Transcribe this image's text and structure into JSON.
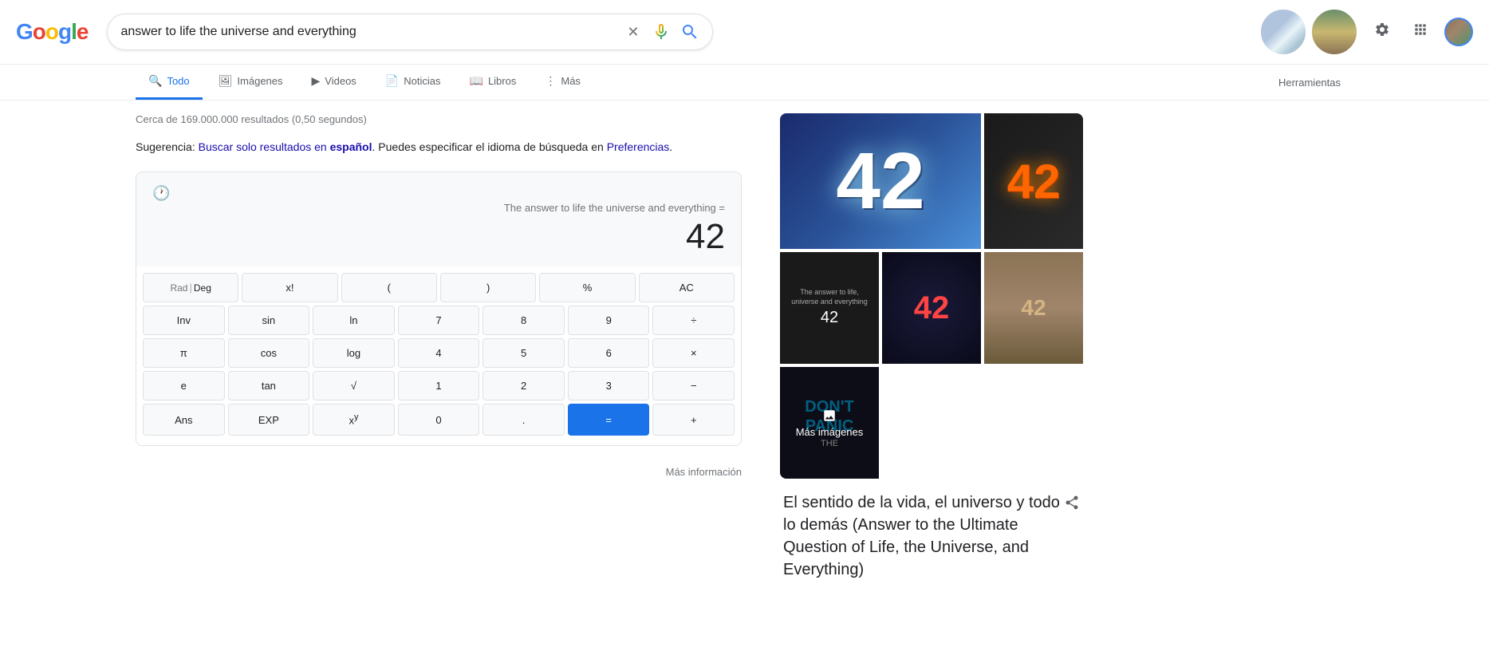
{
  "header": {
    "logo": "Google",
    "logo_letters": [
      "G",
      "o",
      "o",
      "g",
      "l",
      "e"
    ],
    "search_query": "answer to life the universe and everything",
    "clear_btn": "×",
    "settings_icon": "⚙",
    "apps_icon": "⠿"
  },
  "nav": {
    "tabs": [
      {
        "id": "todo",
        "label": "Todo",
        "active": true,
        "icon": "🔍"
      },
      {
        "id": "imagenes",
        "label": "Imágenes",
        "active": false,
        "icon": "🖼"
      },
      {
        "id": "videos",
        "label": "Videos",
        "active": false,
        "icon": "▶"
      },
      {
        "id": "noticias",
        "label": "Noticias",
        "active": false,
        "icon": "📄"
      },
      {
        "id": "libros",
        "label": "Libros",
        "active": false,
        "icon": "📖"
      },
      {
        "id": "mas",
        "label": "Más",
        "active": false,
        "icon": "⋮"
      },
      {
        "id": "herramientas",
        "label": "Herramientas",
        "active": false
      }
    ]
  },
  "results": {
    "count": "Cerca de 169.000.000 resultados (0,50 segundos)",
    "suggestion_prefix": "Sugerencia: ",
    "suggestion_link1": "Buscar solo resultados en ",
    "suggestion_lang": "español",
    "suggestion_suffix": ". Puedes especificar el idioma de búsqueda en ",
    "suggestion_link2": "Preferencias",
    "suggestion_end": "."
  },
  "calculator": {
    "history_icon": "🕐",
    "expression": "The answer to life the universe and everything =",
    "result": "42",
    "more_info": "Más información",
    "buttons": [
      [
        {
          "label": "Rad",
          "type": "rad"
        },
        {
          "label": "Deg",
          "type": "deg"
        },
        {
          "label": "x!",
          "type": "func"
        },
        {
          "label": "(",
          "type": "func"
        },
        {
          "label": ")",
          "type": "func"
        },
        {
          "label": "%",
          "type": "func"
        },
        {
          "label": "AC",
          "type": "func"
        }
      ],
      [
        {
          "label": "Inv",
          "type": "func"
        },
        {
          "label": "sin",
          "type": "func"
        },
        {
          "label": "ln",
          "type": "func"
        },
        {
          "label": "7",
          "type": "num"
        },
        {
          "label": "8",
          "type": "num"
        },
        {
          "label": "9",
          "type": "num"
        },
        {
          "label": "÷",
          "type": "operator"
        }
      ],
      [
        {
          "label": "π",
          "type": "func"
        },
        {
          "label": "cos",
          "type": "func"
        },
        {
          "label": "log",
          "type": "func"
        },
        {
          "label": "4",
          "type": "num"
        },
        {
          "label": "5",
          "type": "num"
        },
        {
          "label": "6",
          "type": "num"
        },
        {
          "label": "×",
          "type": "operator"
        }
      ],
      [
        {
          "label": "e",
          "type": "func"
        },
        {
          "label": "tan",
          "type": "func"
        },
        {
          "label": "√",
          "type": "func"
        },
        {
          "label": "1",
          "type": "num"
        },
        {
          "label": "2",
          "type": "num"
        },
        {
          "label": "3",
          "type": "num"
        },
        {
          "label": "−",
          "type": "operator"
        }
      ],
      [
        {
          "label": "Ans",
          "type": "func"
        },
        {
          "label": "EXP",
          "type": "func"
        },
        {
          "label": "xʸ",
          "type": "func"
        },
        {
          "label": "0",
          "type": "num"
        },
        {
          "label": ".",
          "type": "num"
        },
        {
          "label": "=",
          "type": "equals"
        },
        {
          "label": "+",
          "type": "operator"
        }
      ]
    ]
  },
  "knowledge_panel": {
    "more_images": "Más imágenes",
    "title": "El sentido de la vida, el universo y todo lo demás (Answer to the Ultimate Question of Life, the Universe, and Everything)",
    "share_icon": "⤴"
  }
}
